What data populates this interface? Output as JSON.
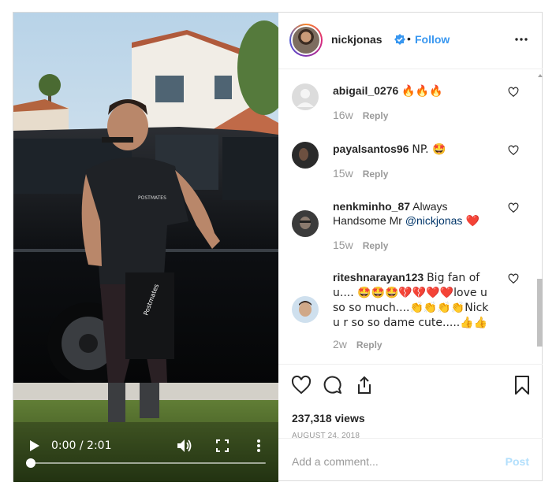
{
  "video": {
    "time": "0:00 / 2:01",
    "progress": 0.0,
    "shirt_text": "POSTMATES",
    "bag_text": "Postmates"
  },
  "header": {
    "username": "nickjonas",
    "separator": "•",
    "follow_label": "Follow",
    "verified": true,
    "accent": "#3897f0"
  },
  "comments": [
    {
      "user": "abigail_0276",
      "text": "🔥🔥🔥",
      "age": "16w",
      "reply": "Reply"
    },
    {
      "user": "payalsantos96",
      "text": "NP. 🤩",
      "age": "15w",
      "reply": "Reply"
    },
    {
      "user": "nenkminho_87",
      "text": "Always Handsome Mr ",
      "mention": "@nickjonas",
      "suffix": " ❤️",
      "age": "15w",
      "reply": "Reply"
    },
    {
      "user": "riteshnarayan123",
      "text": "Big fan of u.... 🤩🤩🤩💔💔❤️❤️love u so so much....👏👏👏👏Nick u r so so dame cute.....👍👍",
      "age": "2w",
      "reply": "Reply"
    }
  ],
  "stats": {
    "views": "237,318 views",
    "date": "AUGUST 24, 2018"
  },
  "composer": {
    "placeholder": "Add a comment...",
    "post_label": "Post"
  },
  "icons": {
    "play": "play-icon",
    "volume": "volume-icon",
    "fullscreen": "fullscreen-icon",
    "more": "more-vertical-icon",
    "like": "heart-icon",
    "comment": "comment-icon",
    "share": "share-icon",
    "save": "bookmark-icon"
  }
}
